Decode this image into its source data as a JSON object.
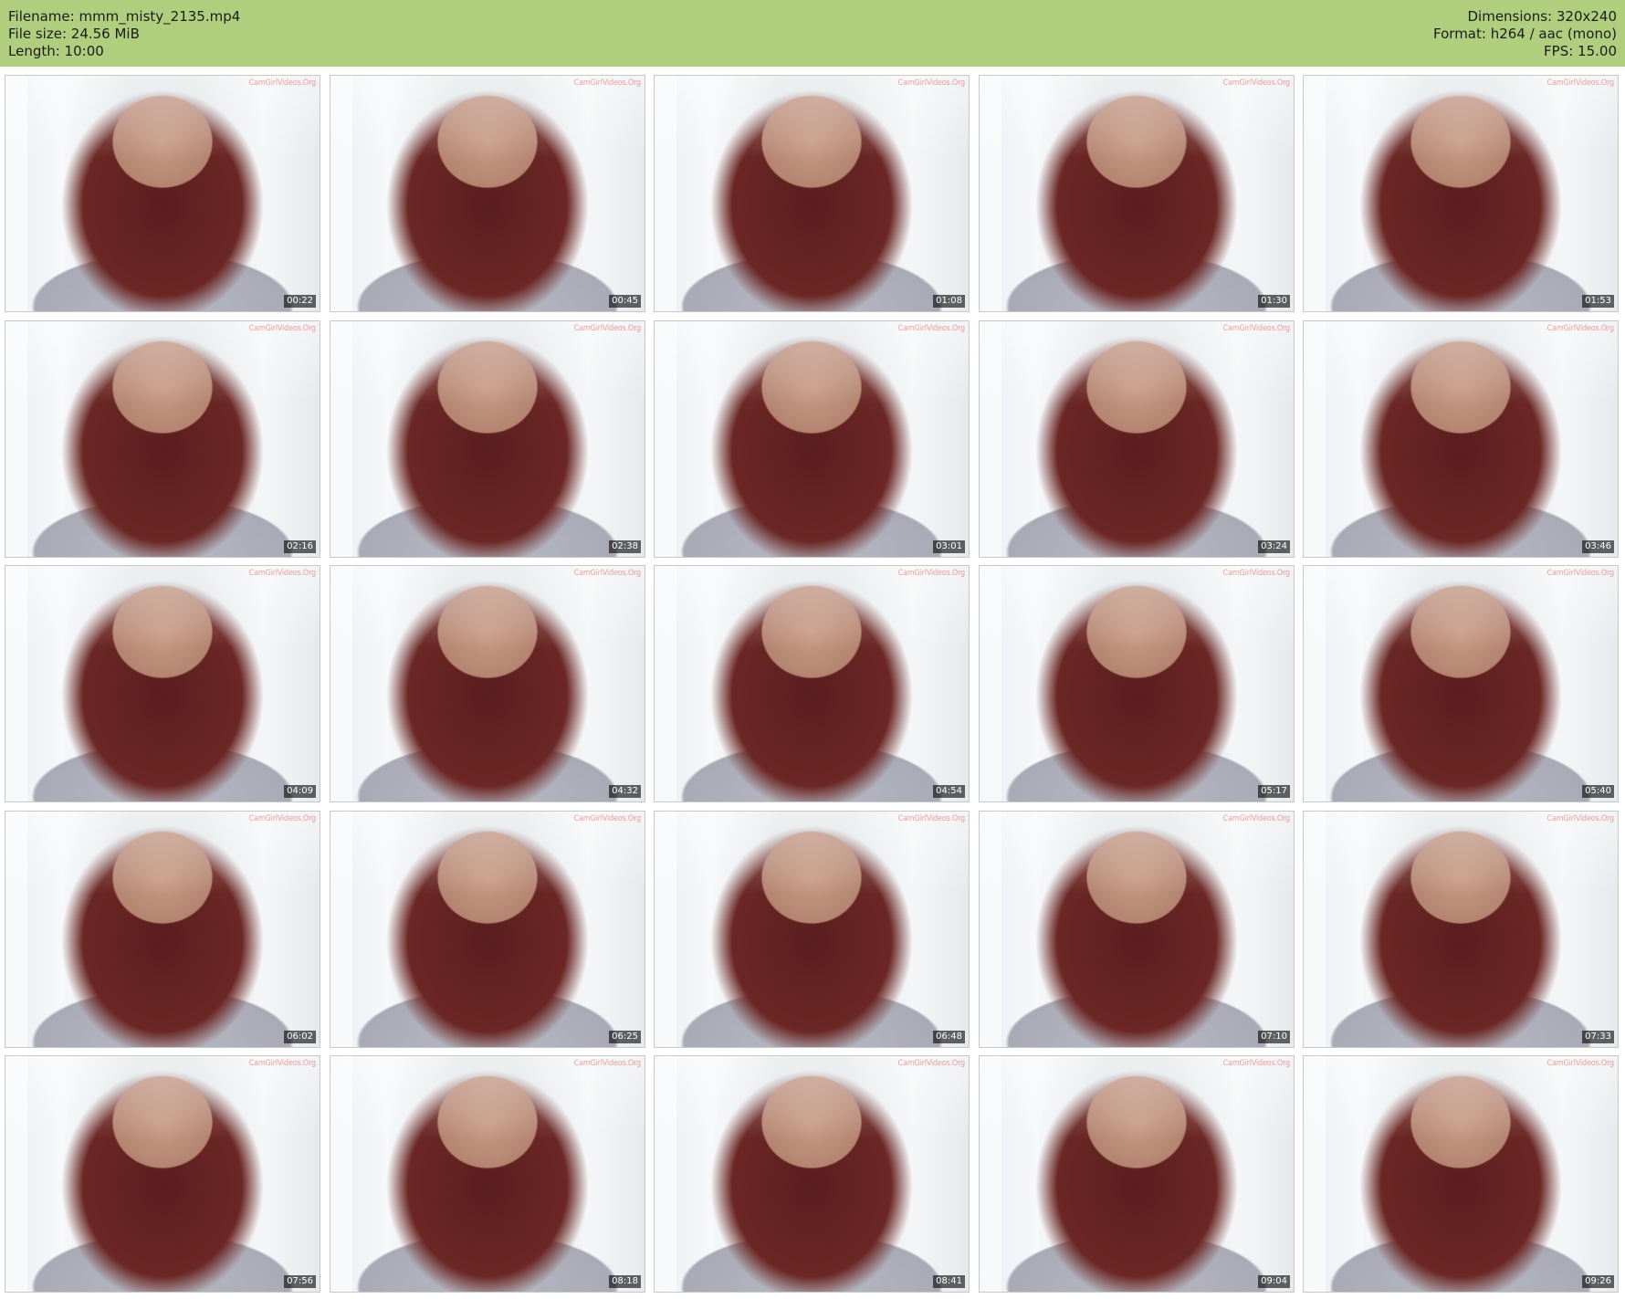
{
  "header": {
    "filename_line": "Filename: mmm_misty_2135.mp4",
    "filesize_line": "File size: 24.56 MiB",
    "length_line": "Length: 10:00",
    "dimensions_line": "Dimensions: 320x240",
    "format_line": "Format: h264 / aac (mono)",
    "fps_line": "FPS: 15.00"
  },
  "watermark_text": "CamGirlVideos.Org",
  "thumbnails": [
    {
      "timecode": "00:22"
    },
    {
      "timecode": "00:45"
    },
    {
      "timecode": "01:08"
    },
    {
      "timecode": "01:30"
    },
    {
      "timecode": "01:53"
    },
    {
      "timecode": "02:16"
    },
    {
      "timecode": "02:38"
    },
    {
      "timecode": "03:01"
    },
    {
      "timecode": "03:24"
    },
    {
      "timecode": "03:46"
    },
    {
      "timecode": "04:09"
    },
    {
      "timecode": "04:32"
    },
    {
      "timecode": "04:54"
    },
    {
      "timecode": "05:17"
    },
    {
      "timecode": "05:40"
    },
    {
      "timecode": "06:02"
    },
    {
      "timecode": "06:25"
    },
    {
      "timecode": "06:48"
    },
    {
      "timecode": "07:10"
    },
    {
      "timecode": "07:33"
    },
    {
      "timecode": "07:56"
    },
    {
      "timecode": "08:18"
    },
    {
      "timecode": "08:41"
    },
    {
      "timecode": "09:04"
    },
    {
      "timecode": "09:26"
    }
  ]
}
